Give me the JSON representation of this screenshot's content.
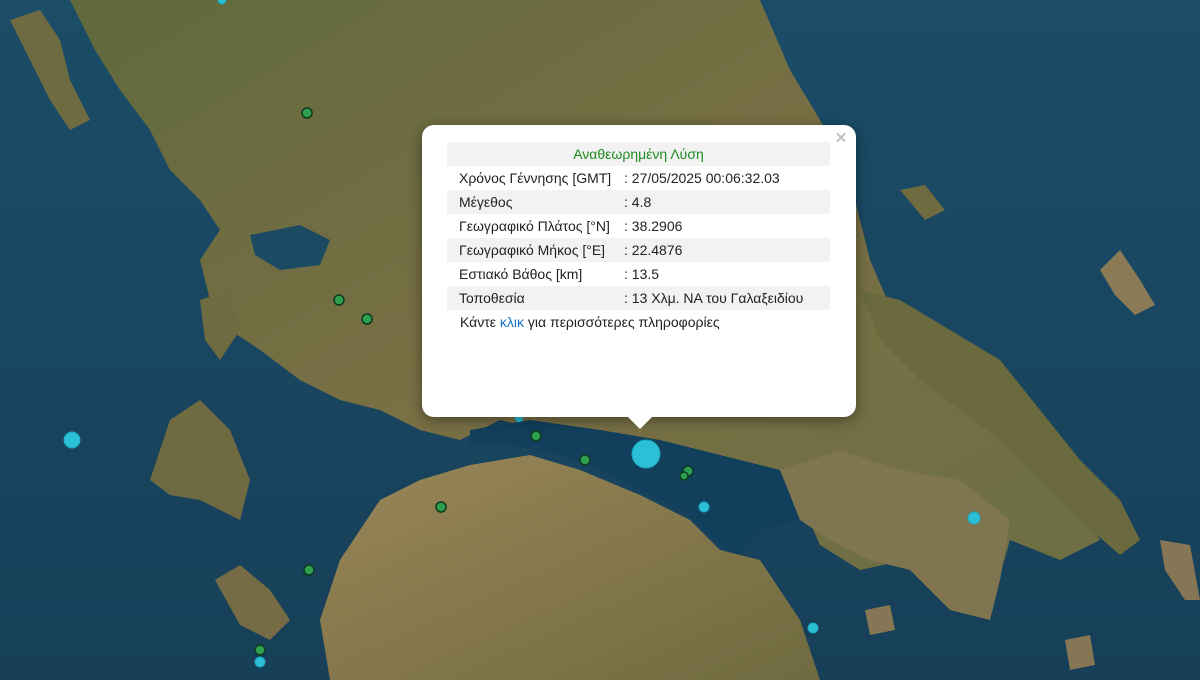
{
  "popup": {
    "title": "Αναθεωρημένη Λύση",
    "close_glyph": "×",
    "rows": [
      {
        "key": "Χρόνος Γέννησης [GMT]",
        "value": ": 27/05/2025 00:06:32.03"
      },
      {
        "key": "Μέγεθος",
        "value": ": 4.8"
      },
      {
        "key": "Γεωγραφικό Πλάτος [°N]",
        "value": ": 38.2906"
      },
      {
        "key": "Γεωγραφικό Μήκος [°E]",
        "value": ": 22.4876"
      },
      {
        "key": "Εστιακό Βάθος [km]",
        "value": ": 13.5"
      },
      {
        "key": "Τοποθεσία",
        "value": ": 13 Χλμ. ΝΑ του Γαλαξειδίου"
      }
    ],
    "more_prefix": "Κάντε ",
    "more_link": "κλικ",
    "more_suffix": " για περισσότερες πληροφορίες"
  },
  "colors": {
    "marker_cyan": "#2bc0d6",
    "marker_green": "#2e9e4f",
    "title_green": "#1e8a21",
    "link_blue": "#1473c4",
    "sea": "#1d4a63",
    "land": "#6b6a3e"
  }
}
